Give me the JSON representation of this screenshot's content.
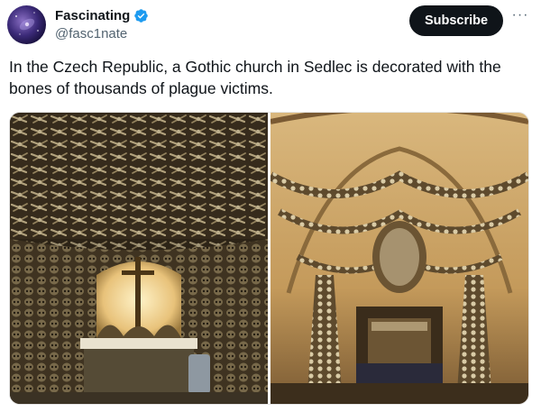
{
  "post": {
    "author": {
      "display_name": "Fascinating",
      "handle": "@fasc1nate",
      "verified": true,
      "avatar_icon": "galaxy-avatar"
    },
    "actions": {
      "subscribe_label": "Subscribe",
      "more_label": "···"
    },
    "text": "In the Czech Republic, a Gothic church in Sedlec is decorated with the bones of thousands of plague victims.",
    "media": [
      {
        "icon": "ossuary-altar-photo"
      },
      {
        "icon": "ossuary-chandelier-photo"
      }
    ]
  },
  "colors": {
    "text": "#0f1419",
    "secondary_text": "#536471",
    "verified_blue": "#1d9bf0",
    "button_bg": "#0f1419",
    "button_text": "#ffffff"
  }
}
